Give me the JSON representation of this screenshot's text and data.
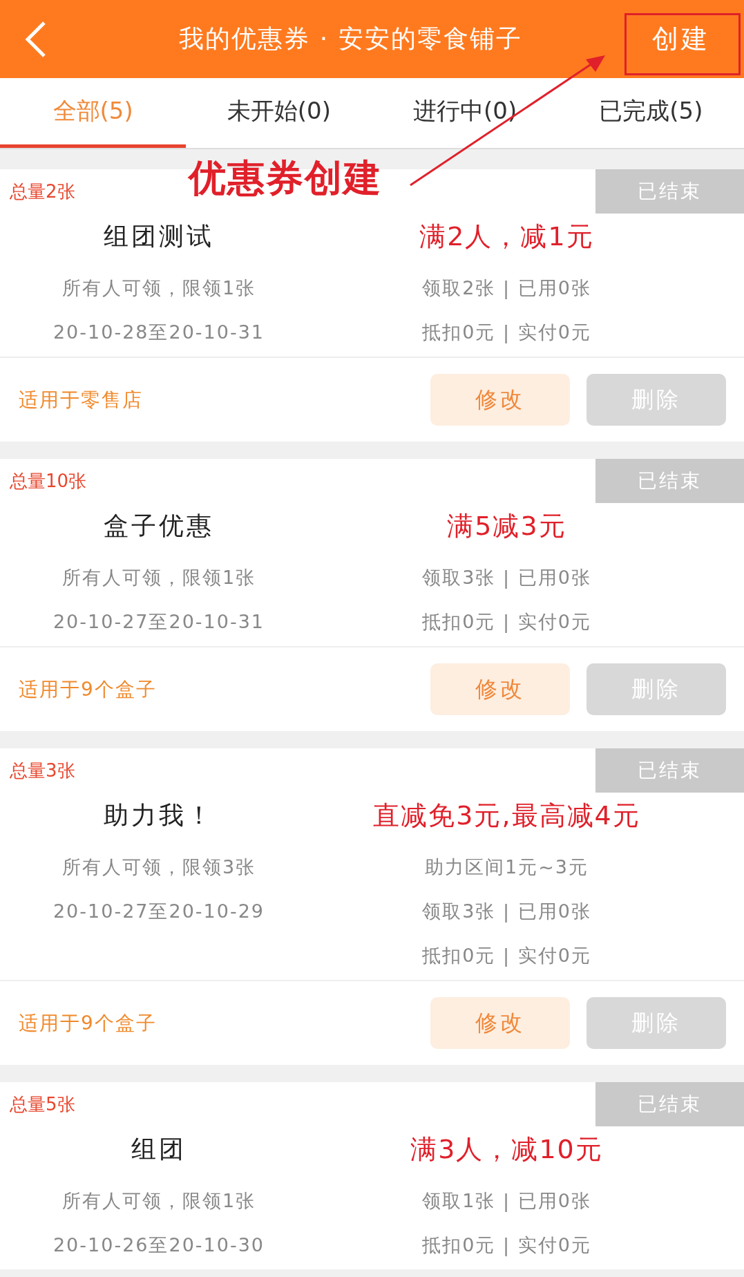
{
  "header": {
    "title": "我的优惠券 · 安安的零食铺子",
    "create_button": "创建"
  },
  "tabs": [
    {
      "label": "全部(5)",
      "selected": true
    },
    {
      "label": "未开始(0)",
      "selected": false
    },
    {
      "label": "进行中(0)",
      "selected": false
    },
    {
      "label": "已完成(5)",
      "selected": false
    }
  ],
  "coupons": [
    {
      "total": "总量2张",
      "status": "已结束",
      "name": "组团测试",
      "rule": "满2人，减1元",
      "limit": "所有人可领，限领1张",
      "dates": "20-10-28至20-10-31",
      "stats": [
        "领取2张 | 已用0张",
        "抵扣0元 | 实付0元"
      ],
      "scope": "适用于零售店",
      "buttons": [
        {
          "label": "修改",
          "kind": "edit"
        },
        {
          "label": "删除",
          "kind": "delete"
        }
      ]
    },
    {
      "total": "总量10张",
      "status": "已结束",
      "name": "盒子优惠",
      "rule": "满5减3元",
      "limit": "所有人可领，限领1张",
      "dates": "20-10-27至20-10-31",
      "stats": [
        "领取3张 | 已用0张",
        "抵扣0元 | 实付0元"
      ],
      "scope": "适用于9个盒子",
      "buttons": [
        {
          "label": "修改",
          "kind": "edit"
        },
        {
          "label": "删除",
          "kind": "delete"
        }
      ]
    },
    {
      "total": "总量3张",
      "status": "已结束",
      "name": "助力我！",
      "rule": "直减免3元,最高减4元",
      "limit": "所有人可领，限领3张",
      "dates": "20-10-27至20-10-29",
      "stats": [
        "助力区间1元~3元",
        "领取3张 | 已用0张",
        "抵扣0元 | 实付0元"
      ],
      "scope": "适用于9个盒子",
      "buttons": [
        {
          "label": "修改",
          "kind": "edit"
        },
        {
          "label": "删除",
          "kind": "delete"
        }
      ]
    },
    {
      "total": "总量5张",
      "status": "已结束",
      "name": "组团",
      "rule": "满3人，减10元",
      "limit": "所有人可领，限领1张",
      "dates": "20-10-26至20-10-30",
      "stats": [
        "领取1张 | 已用0张",
        "抵扣0元 | 实付0元"
      ]
    }
  ],
  "annotation": {
    "label": "优惠券创建"
  }
}
